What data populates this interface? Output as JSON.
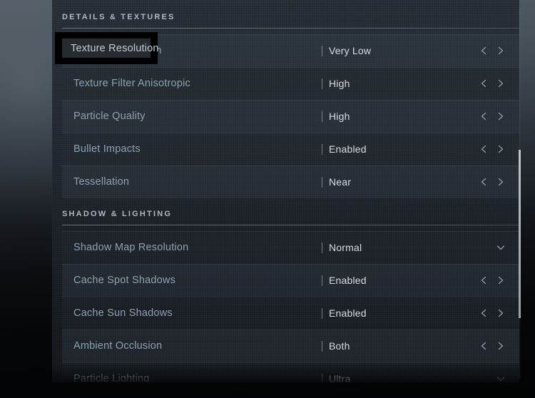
{
  "panel": {
    "scrollbar": {
      "present": true
    },
    "sections": [
      {
        "title": "DETAILS & TEXTURES",
        "rows": [
          {
            "label": "Texture Resolution",
            "value": "Very Low",
            "control": "arrows",
            "focused": true
          },
          {
            "label": "Texture Filter Anisotropic",
            "value": "High",
            "control": "arrows",
            "focused": false
          },
          {
            "label": "Particle Quality",
            "value": "High",
            "control": "arrows",
            "focused": false
          },
          {
            "label": "Bullet Impacts",
            "value": "Enabled",
            "control": "arrows",
            "focused": false
          },
          {
            "label": "Tessellation",
            "value": "Near",
            "control": "arrows",
            "focused": false
          }
        ]
      },
      {
        "title": "SHADOW & LIGHTING",
        "rows": [
          {
            "label": "Shadow Map Resolution",
            "value": "Normal",
            "control": "dropdown",
            "focused": false
          },
          {
            "label": "Cache Spot Shadows",
            "value": "Enabled",
            "control": "arrows",
            "focused": false
          },
          {
            "label": "Cache Sun Shadows",
            "value": "Enabled",
            "control": "arrows",
            "focused": false
          },
          {
            "label": "Ambient Occlusion",
            "value": "Both",
            "control": "arrows",
            "focused": false
          },
          {
            "label": "Particle Lighting",
            "value": "Ultra",
            "control": "dropdown",
            "focused": false
          }
        ]
      }
    ]
  },
  "icons": {
    "chevron_left": "chevron-left-icon",
    "chevron_right": "chevron-right-icon",
    "chevron_down": "chevron-down-icon"
  },
  "colors": {
    "label": "#8fa0ae",
    "value": "#d7dde2",
    "section_title": "#aeb8c0",
    "focus_border": "#000000",
    "scrollbar_thumb": "#d7dee4"
  }
}
